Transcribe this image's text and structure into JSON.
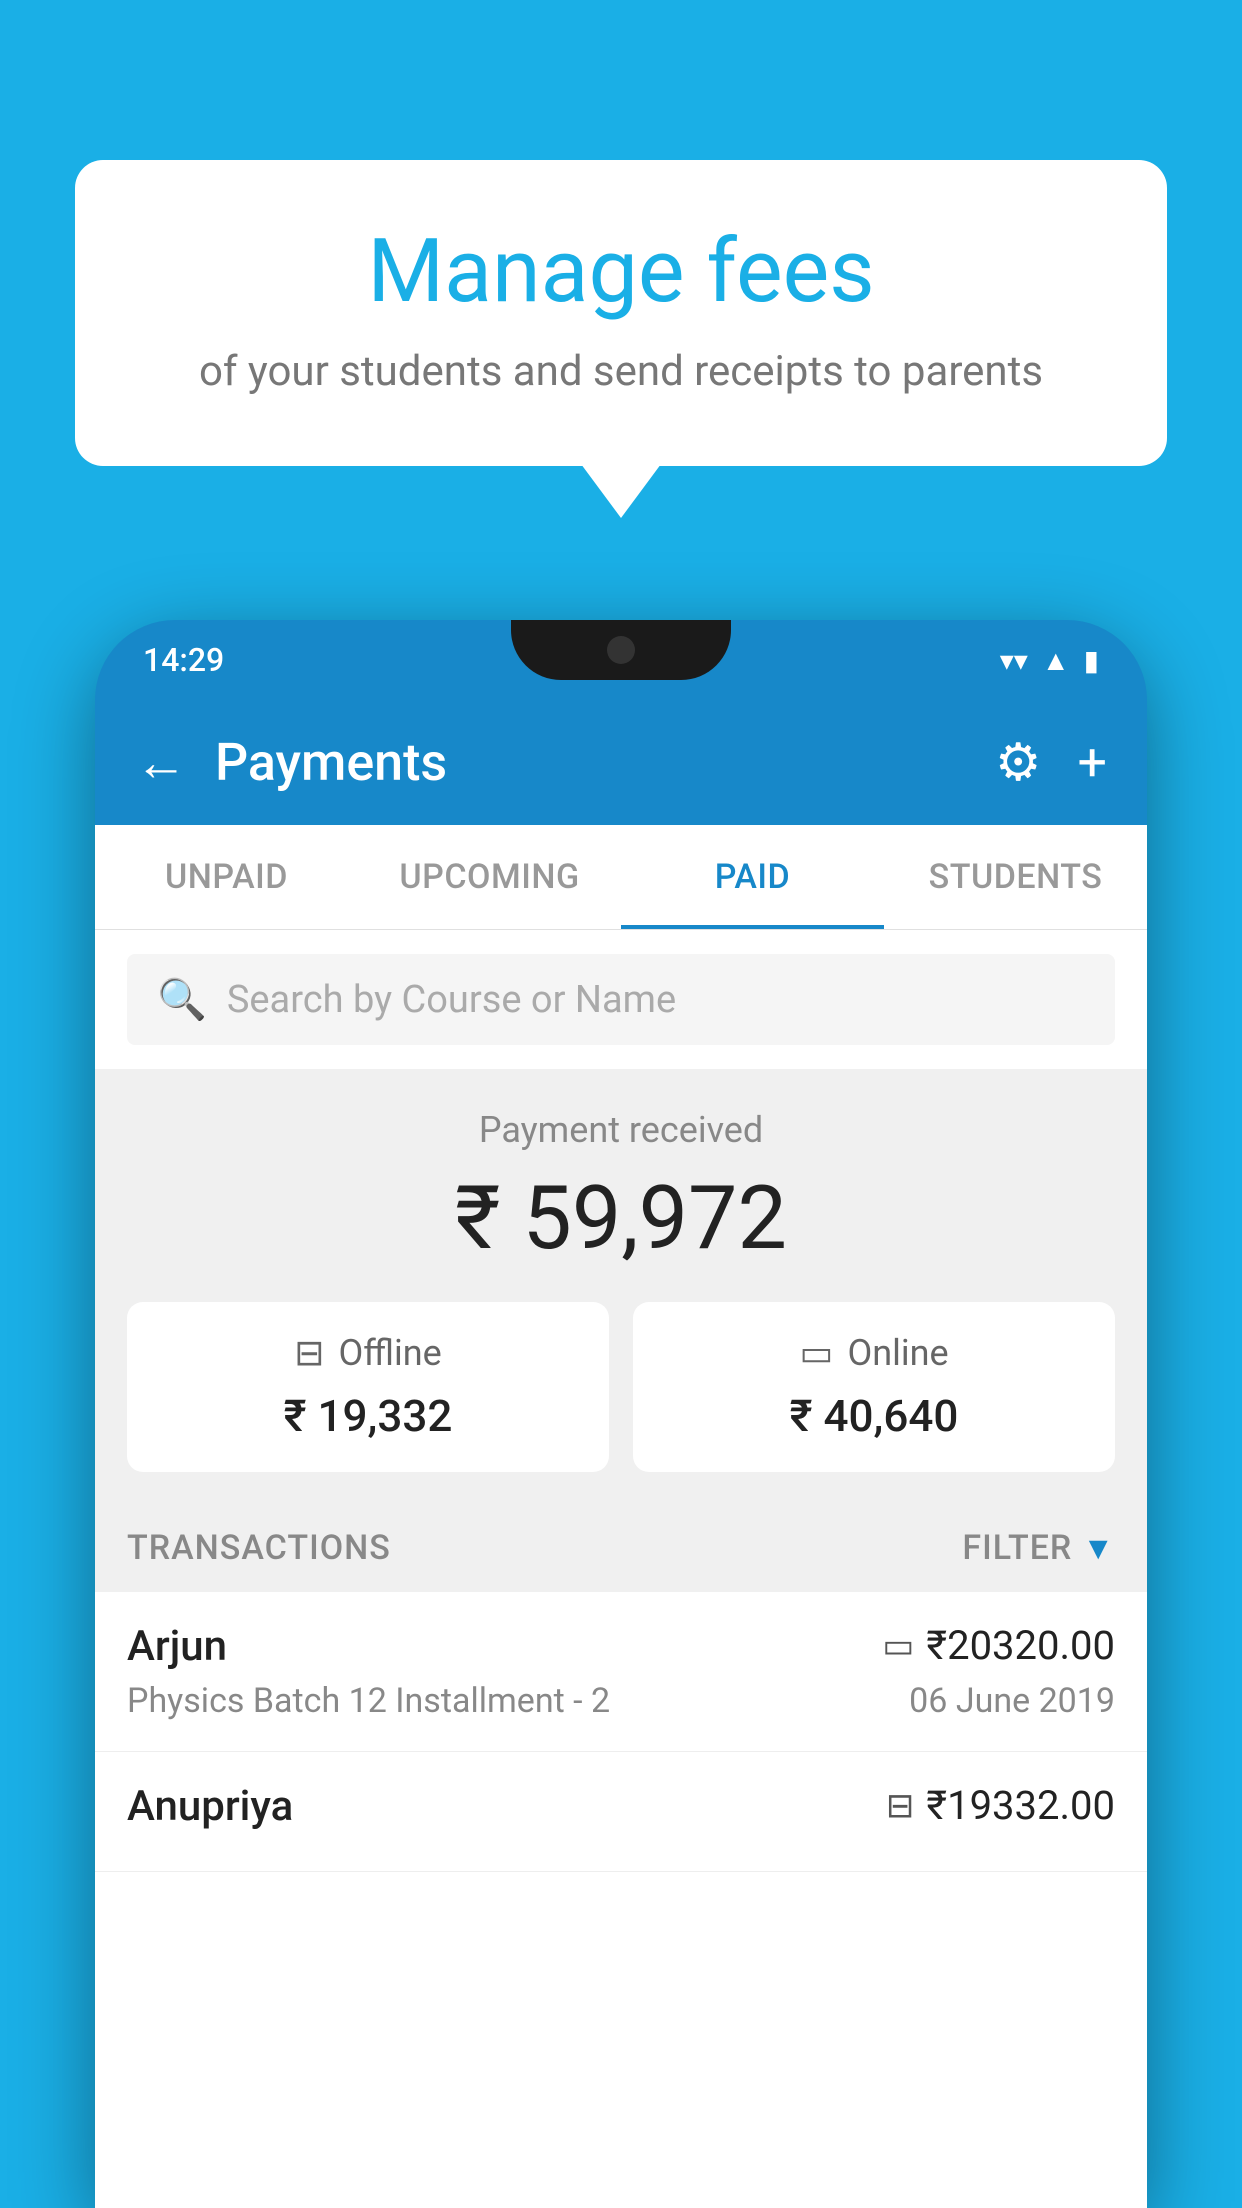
{
  "background_color": "#1AAFE6",
  "speech_bubble": {
    "title": "Manage fees",
    "subtitle": "of your students and send receipts to parents"
  },
  "phone": {
    "status_bar": {
      "time": "14:29"
    },
    "header": {
      "title": "Payments",
      "back_label": "←",
      "settings_label": "⚙",
      "add_label": "+"
    },
    "tabs": [
      {
        "label": "UNPAID",
        "active": false
      },
      {
        "label": "UPCOMING",
        "active": false
      },
      {
        "label": "PAID",
        "active": true
      },
      {
        "label": "STUDENTS",
        "active": false
      }
    ],
    "search": {
      "placeholder": "Search by Course or Name"
    },
    "payment_summary": {
      "label": "Payment received",
      "total": "₹ 59,972",
      "offline": {
        "label": "Offline",
        "amount": "₹ 19,332"
      },
      "online": {
        "label": "Online",
        "amount": "₹ 40,640"
      }
    },
    "transactions": {
      "section_label": "TRANSACTIONS",
      "filter_label": "FILTER",
      "items": [
        {
          "name": "Arjun",
          "course": "Physics Batch 12 Installment - 2",
          "amount": "₹20320.00",
          "date": "06 June 2019",
          "payment_type": "online"
        },
        {
          "name": "Anupriya",
          "course": "",
          "amount": "₹19332.00",
          "date": "",
          "payment_type": "offline"
        }
      ]
    }
  }
}
